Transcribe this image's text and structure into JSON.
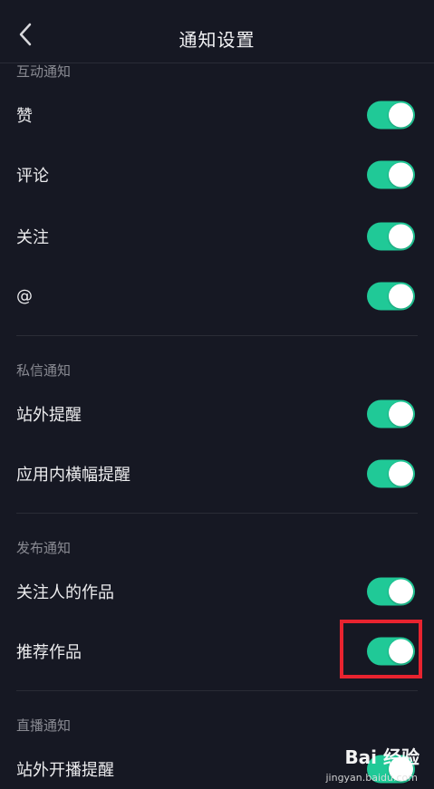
{
  "header": {
    "title": "通知设置"
  },
  "colors": {
    "accent": "#20c997",
    "background": "#161823",
    "highlight": "#e8232f"
  },
  "sections": [
    {
      "label": "互动通知",
      "items": [
        {
          "label": "赞",
          "on": true
        },
        {
          "label": "评论",
          "on": true
        },
        {
          "label": "关注",
          "on": true
        },
        {
          "label": "@",
          "on": true
        }
      ]
    },
    {
      "label": "私信通知",
      "items": [
        {
          "label": "站外提醒",
          "on": true
        },
        {
          "label": "应用内横幅提醒",
          "on": true
        }
      ]
    },
    {
      "label": "发布通知",
      "items": [
        {
          "label": "关注人的作品",
          "on": true
        },
        {
          "label": "推荐作品",
          "on": true
        }
      ]
    },
    {
      "label": "直播通知",
      "items": [
        {
          "label": "站外开播提醒",
          "on": true
        }
      ]
    }
  ],
  "watermark": {
    "brand": "Bai 经验",
    "url": "jingyan.baidu.com"
  }
}
